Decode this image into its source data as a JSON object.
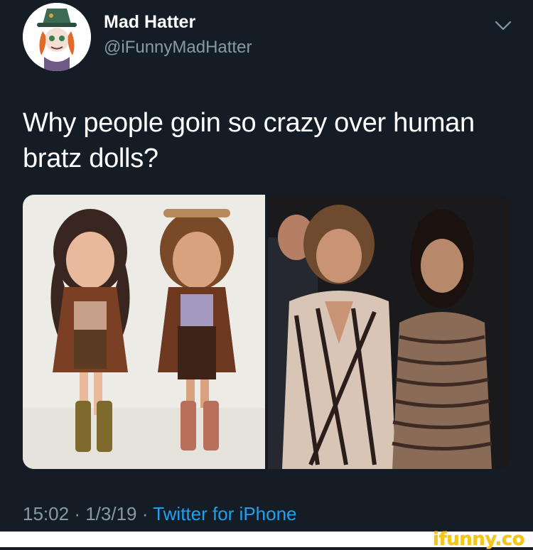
{
  "tweet": {
    "display_name": "Mad Hatter",
    "handle": "@iFunnyMadHatter",
    "text": "Why people goin so crazy over human bratz dolls?",
    "time": "15:02",
    "date": "1/3/19",
    "source": "Twitter for iPhone",
    "separator": "·"
  },
  "icons": {
    "menu": "chevron-down-icon",
    "avatar": "mad-hatter-avatar"
  },
  "watermark": {
    "text": "ifunny.co"
  },
  "colors": {
    "background": "#141d26",
    "secondary_text": "#8899a6",
    "link": "#1da1f2",
    "watermark": "#f5c518"
  }
}
